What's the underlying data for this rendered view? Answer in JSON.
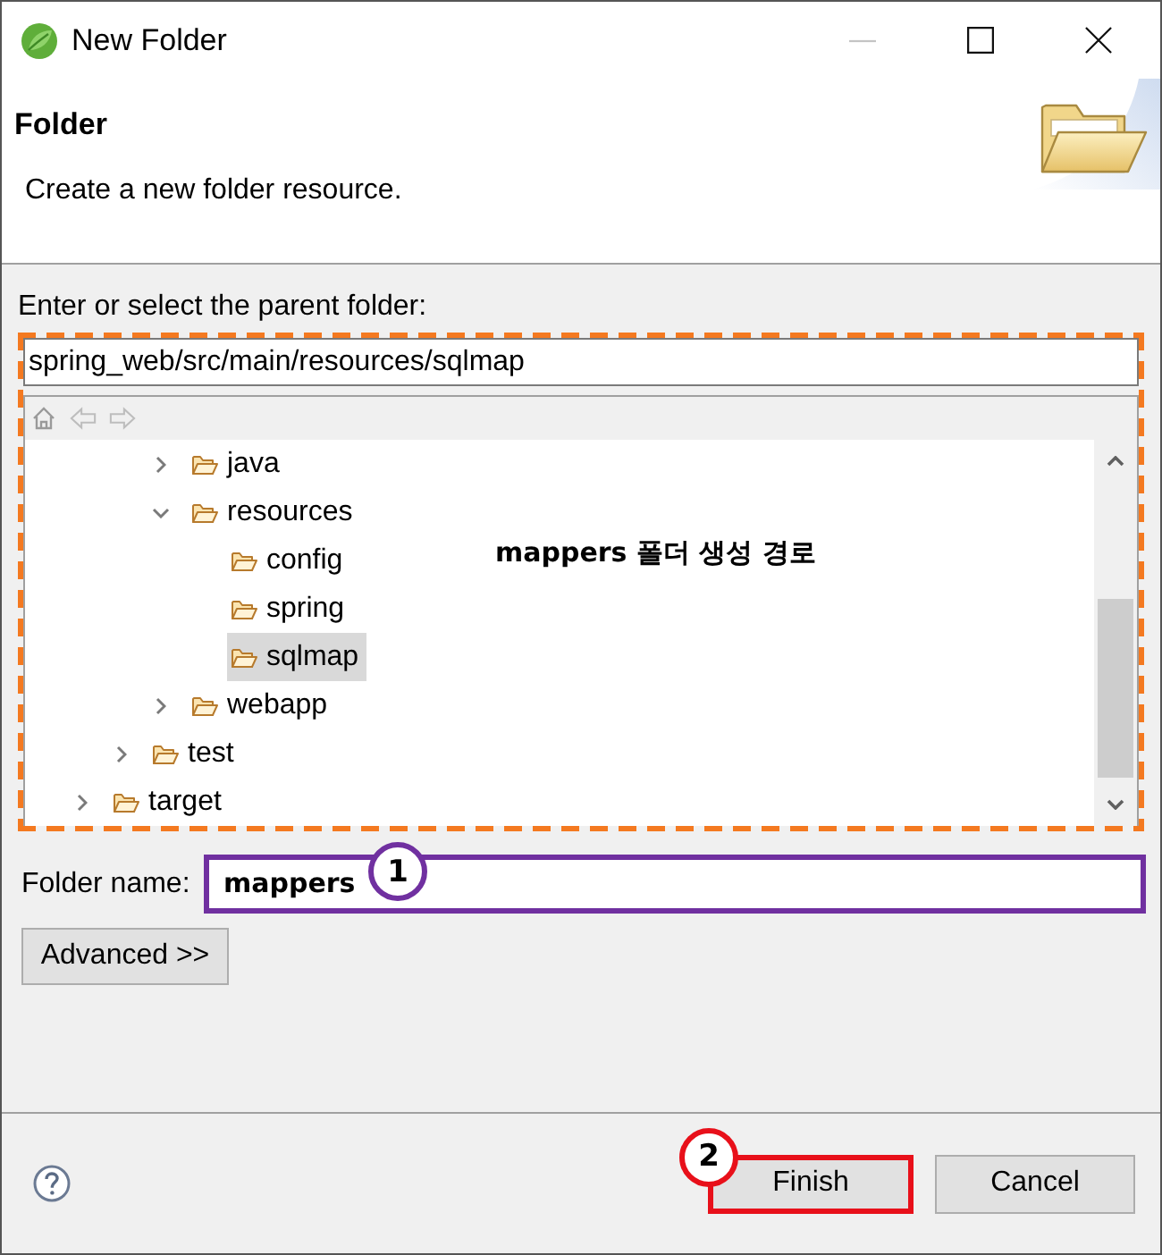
{
  "window": {
    "title": "New Folder",
    "controls": [
      {
        "kind": "minimize",
        "disabled": true
      },
      {
        "kind": "maximize",
        "disabled": false
      },
      {
        "kind": "close",
        "disabled": false
      }
    ]
  },
  "header": {
    "title": "Folder",
    "description": "Create a new folder resource."
  },
  "parent_folder": {
    "label": "Enter or select the parent folder:",
    "value": "spring_web/src/main/resources/sqlmap",
    "highlight": {
      "dashed": true,
      "color": "#f47920"
    }
  },
  "tree": {
    "items": [
      {
        "children": [
          {
            "children": [
              {
                "children": [
                  {
                    "label": "java",
                    "expanded": false,
                    "selected": false
                  },
                  {
                    "label": "resources",
                    "expanded": true,
                    "selected": false,
                    "children": [
                      {
                        "label": "config",
                        "selected": false
                      },
                      {
                        "label": "spring",
                        "selected": false
                      },
                      {
                        "label": "sqlmap",
                        "selected": true
                      }
                    ]
                  },
                  {
                    "label": "webapp",
                    "expanded": false,
                    "selected": false
                  }
                ]
              },
              {
                "label": "test",
                "expanded": false,
                "selected": false
              }
            ]
          },
          {
            "label": "target",
            "expanded": false,
            "selected": false
          }
        ]
      }
    ],
    "note": "mappers 폴더 생성 경로"
  },
  "folder_name": {
    "label": "Folder name:",
    "value": "mappers",
    "highlight": {
      "dashed": false,
      "color": "#7030a0",
      "badge": "1"
    }
  },
  "advanced_button": {
    "label": "Advanced >>"
  },
  "buttons": [
    {
      "label": "Finish",
      "highlight": {
        "dashed": false,
        "color": "#e8101a",
        "badge": "2"
      }
    },
    {
      "label": "Cancel"
    }
  ]
}
